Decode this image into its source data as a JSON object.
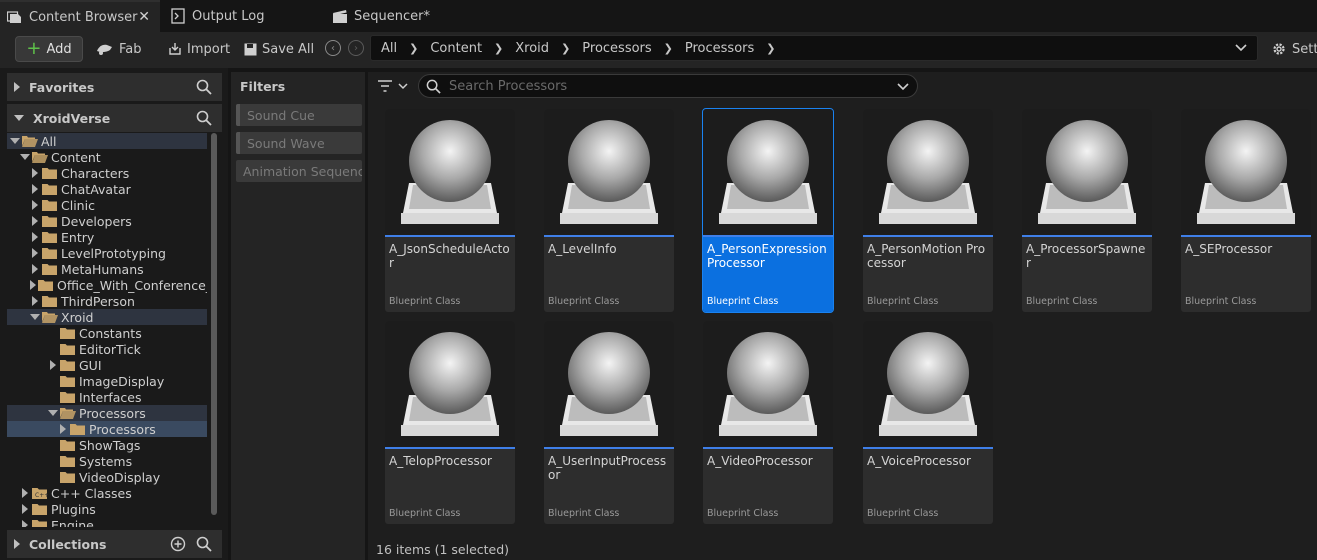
{
  "tabs": [
    {
      "label": "Content Browser",
      "icon": "content-browser-icon",
      "active": true,
      "closable": true
    },
    {
      "label": "Output Log",
      "icon": "output-log-icon",
      "active": false
    },
    {
      "label": "Sequencer*",
      "icon": "sequencer-icon",
      "active": false
    }
  ],
  "toolbar": {
    "add_label": "Add",
    "fab_label": "Fab",
    "import_label": "Import",
    "save_all_label": "Save All",
    "settings_label": "Setti"
  },
  "breadcrumb": [
    "All",
    "Content",
    "Xroid",
    "Processors",
    "Processors"
  ],
  "left_panel": {
    "favorites_label": "Favorites",
    "project_label": "XroidVerse",
    "collections_label": "Collections",
    "tree": [
      {
        "label": "All",
        "depth": 0,
        "expanded": true,
        "highlight": true
      },
      {
        "label": "Content",
        "depth": 1,
        "expanded": true
      },
      {
        "label": "Characters",
        "depth": 2,
        "collapsed": true
      },
      {
        "label": "ChatAvatar",
        "depth": 2,
        "collapsed": true
      },
      {
        "label": "Clinic",
        "depth": 2,
        "collapsed": true
      },
      {
        "label": "Developers",
        "depth": 2,
        "collapsed": true
      },
      {
        "label": "Entry",
        "depth": 2,
        "collapsed": true
      },
      {
        "label": "LevelPrototyping",
        "depth": 2,
        "collapsed": true
      },
      {
        "label": "MetaHumans",
        "depth": 2,
        "collapsed": true
      },
      {
        "label": "Office_With_Conference_",
        "depth": 2,
        "collapsed": true
      },
      {
        "label": "ThirdPerson",
        "depth": 2,
        "collapsed": true
      },
      {
        "label": "Xroid",
        "depth": 2,
        "expanded": true,
        "highlight": true
      },
      {
        "label": "Constants",
        "depth": 3
      },
      {
        "label": "EditorTick",
        "depth": 3
      },
      {
        "label": "GUI",
        "depth": 3,
        "collapsed": true
      },
      {
        "label": "ImageDisplay",
        "depth": 3
      },
      {
        "label": "Interfaces",
        "depth": 3
      },
      {
        "label": "Processors",
        "depth": 3,
        "expanded": true,
        "highlight": true
      },
      {
        "label": "Processors",
        "depth": 4,
        "collapsed": true,
        "selected": true
      },
      {
        "label": "ShowTags",
        "depth": 3
      },
      {
        "label": "Systems",
        "depth": 3
      },
      {
        "label": "VideoDisplay",
        "depth": 3
      },
      {
        "label": "C++ Classes",
        "depth": 1,
        "collapsed": true,
        "cpp": true
      },
      {
        "label": "Plugins",
        "depth": 1,
        "collapsed": true
      },
      {
        "label": "Engine",
        "depth": 1,
        "collapsed": true
      }
    ]
  },
  "filters": {
    "title": "Filters",
    "items": [
      "Sound Cue",
      "Sound Wave",
      "Animation Sequence"
    ]
  },
  "search": {
    "placeholder": "Search Processors",
    "value": ""
  },
  "assets": [
    {
      "name": "A_JsonScheduleActor",
      "type": "Blueprint Class"
    },
    {
      "name": "A_LevelInfo",
      "type": "Blueprint Class"
    },
    {
      "name": "A_PersonExpression Processor",
      "type": "Blueprint Class",
      "selected": true
    },
    {
      "name": "A_PersonMotion Processor",
      "type": "Blueprint Class"
    },
    {
      "name": "A_ProcessorSpawner",
      "type": "Blueprint Class"
    },
    {
      "name": "A_SEProcessor",
      "type": "Blueprint Class"
    },
    {
      "name": "A_TelopProcessor",
      "type": "Blueprint Class"
    },
    {
      "name": "A_UserInputProcessor",
      "type": "Blueprint Class"
    },
    {
      "name": "A_VideoProcessor",
      "type": "Blueprint Class"
    },
    {
      "name": "A_VoiceProcessor",
      "type": "Blueprint Class"
    }
  ],
  "status": "16 items (1 selected)",
  "colors": {
    "accent": "#0b70e0",
    "asset_bar": "#3f7fe8",
    "folder": "#c8a46a"
  }
}
